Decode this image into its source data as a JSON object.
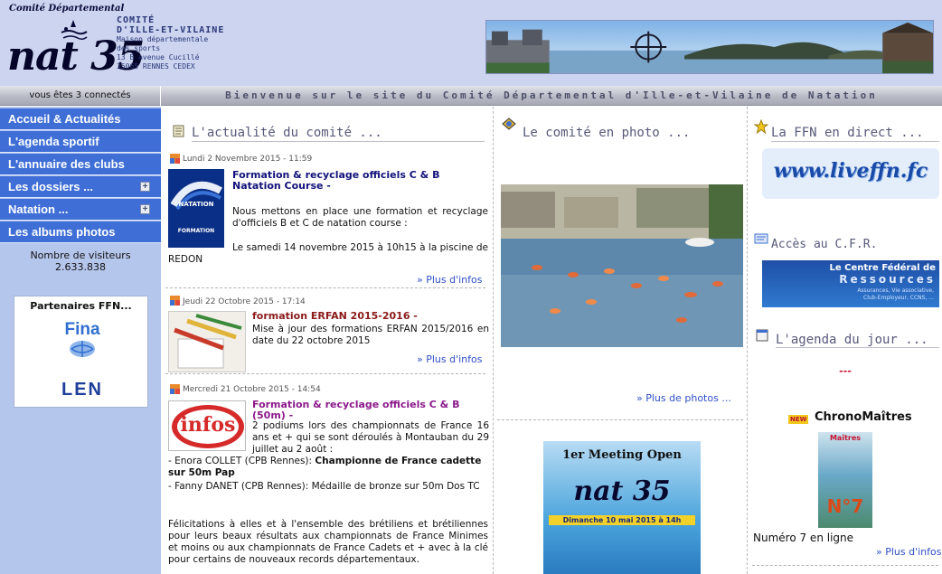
{
  "header": {
    "logo_top": "Comité Départemental",
    "logo_text": "nat 35",
    "org_lines": [
      "COMITÉ",
      "D'ILLE-ET-VILAINE",
      "Maison départementale",
      "des sports",
      "13 B avenue Cucillé",
      "35065 RENNES CEDEX"
    ]
  },
  "welcome_bar": {
    "connected": "vous êtes 3 connectés",
    "welcome": "Bienvenue sur le site du Comité Départemental d'Ille-et-Vilaine de Natation"
  },
  "sidebar": {
    "menu": [
      {
        "label": "Accueil & Actualités",
        "expandable": false
      },
      {
        "label": "L'agenda sportif",
        "expandable": false
      },
      {
        "label": "L'annuaire des clubs",
        "expandable": false
      },
      {
        "label": "Les dossiers ...",
        "expandable": true
      },
      {
        "label": "Natation ...",
        "expandable": true
      },
      {
        "label": "Les albums photos",
        "expandable": false
      }
    ],
    "visitors_label": "Nombre de visiteurs",
    "visitors_count": "2.633.838",
    "partners_title": "Partenaires FFN...",
    "fina_logo": "Fina",
    "len_logo": "LEN"
  },
  "col1": {
    "heading": "L'actualité du comité ...",
    "news": [
      {
        "date": "Lundi 2 Novembre 2015 - 11:59",
        "title": "Formation & recyclage officiels C & B Natation Course -",
        "thumb_labels": [
          "NATATION",
          "FORMATION"
        ],
        "text1": "Nous mettons en place une formation et recyclage d'officiels B et C de natation course :",
        "text2": "Le samedi 14 novembre 2015 à 10h15 à la piscine de REDON",
        "more": "Plus d'infos"
      },
      {
        "date": "Jeudi 22 Octobre 2015 - 17:14",
        "title": "formation ERFAN 2015-2016 -",
        "text1": "Mise à jour des formations ERFAN 2015/2016 en date du 22 octobre 2015",
        "more": "Plus d'infos"
      },
      {
        "date": "Mercredi 21 Octobre 2015 - 14:54",
        "title": "Formation & recyclage officiels C & B (50m) -",
        "thumb_label": "infos",
        "text1": "2 podiums lors des championnats de France 16 ans et + qui se sont déroulés à Montauban du 29 juillet au 2 août :",
        "bullet1_pre": "- Enora COLLET (CPB Rennes): ",
        "bullet1_bold": "Championne de France cadette sur 50m Pap",
        "bullet2": "- Fanny DANET (CPB Rennes): Médaille de bronze sur 50m Dos TC",
        "text3": "Félicitations à elles et à l'ensemble des brétiliens et brétiliennes pour leurs beaux résultats aux championnats de France Minimes et moins ou aux championnats de France Cadets et + avec à la clé pour certains de nouveaux records départementaux."
      }
    ]
  },
  "col2": {
    "heading": "Le comité en photo ...",
    "more_photos": "Plus de photos ...",
    "poster_title": "1er Meeting Open",
    "poster_logo": "nat 35",
    "poster_date": "Dimanche 10 mai 2015 à 14h"
  },
  "col3": {
    "ffn_heading": "La FFN en direct ...",
    "liveffn": "www.liveffn.fc",
    "cfr_heading": "Accès au C.F.R.",
    "cfr_line1": "Le Centre Fédéral de",
    "cfr_line2": "Ressources",
    "cfr_line3": "Assurances, Vie associative,",
    "cfr_line4": "Club-Employeur, CCNS, ...",
    "agenda_heading": "L'agenda du jour ...",
    "agenda_empty": "---",
    "new_badge": "NEW",
    "chrono_title": "ChronoMaîtres",
    "mag_title": "Maîtres",
    "mag_number": "N°7",
    "chrono_caption": "Numéro 7 en ligne",
    "more": "Plus d'infos"
  },
  "colors": {
    "header_bg": "#ccd4ef",
    "menu_bg": "#3e6ed6",
    "sidebar_bg": "#b5c6ec",
    "link": "#2f4fc7",
    "news_title_1": "#12127a",
    "news_title_2": "#8b1a1a",
    "news_title_3": "#8b1a8b"
  }
}
